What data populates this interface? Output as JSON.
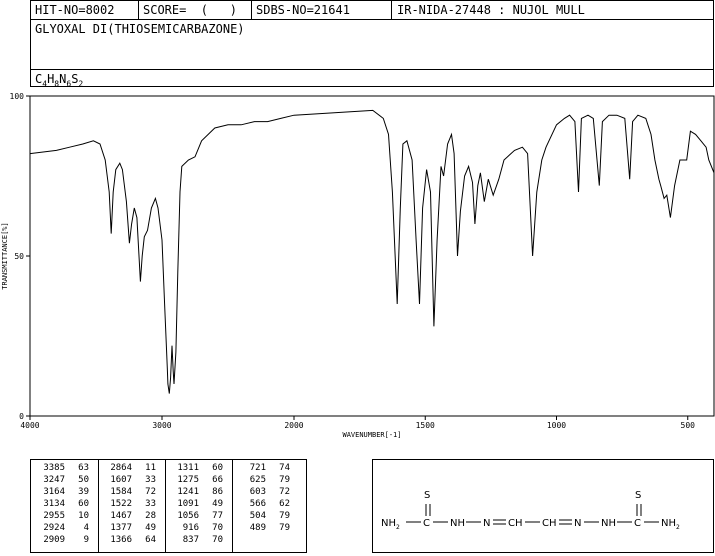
{
  "header": {
    "hit_no": "HIT-NO=8002",
    "score": "SCORE=  (   )",
    "sdbs_no": "SDBS-NO=21641",
    "ir_info": "IR-NIDA-27448 : NUJOL MULL",
    "compound": "GLYOXAL DI(THIOSEMICARBAZONE)",
    "formula_parts": [
      "C",
      "4",
      "H",
      "8",
      "N",
      "6",
      "S",
      "2"
    ]
  },
  "chart_data": {
    "type": "line",
    "xlabel": "WAVENUMBER[-1]",
    "ylabel": "TRANSMITTANCE[%]",
    "xlim": [
      4000,
      400
    ],
    "ylim": [
      0,
      100
    ],
    "x_ticks": [
      "4000",
      "3000",
      "2000",
      "1500",
      "1000",
      "500"
    ],
    "y_ticks": [
      "100",
      "50",
      "0"
    ],
    "x_tick_values": [
      4000,
      3000,
      2000,
      1500,
      1000,
      500
    ],
    "y_tick_values": [
      100,
      50,
      0
    ],
    "series": [
      {
        "points": [
          [
            4000,
            82
          ],
          [
            3900,
            82.5
          ],
          [
            3800,
            83
          ],
          [
            3700,
            84
          ],
          [
            3600,
            85
          ],
          [
            3520,
            86
          ],
          [
            3470,
            85
          ],
          [
            3430,
            80
          ],
          [
            3400,
            70
          ],
          [
            3385,
            57
          ],
          [
            3370,
            70
          ],
          [
            3350,
            77
          ],
          [
            3320,
            79
          ],
          [
            3300,
            77
          ],
          [
            3270,
            67
          ],
          [
            3247,
            54
          ],
          [
            3230,
            60
          ],
          [
            3210,
            65
          ],
          [
            3190,
            62
          ],
          [
            3164,
            42
          ],
          [
            3150,
            50
          ],
          [
            3134,
            56
          ],
          [
            3110,
            58
          ],
          [
            3080,
            65
          ],
          [
            3050,
            68
          ],
          [
            3030,
            65
          ],
          [
            3000,
            55
          ],
          [
            2980,
            35
          ],
          [
            2960,
            15
          ],
          [
            2955,
            10
          ],
          [
            2945,
            7
          ],
          [
            2935,
            12
          ],
          [
            2924,
            22
          ],
          [
            2915,
            14
          ],
          [
            2909,
            10
          ],
          [
            2895,
            20
          ],
          [
            2880,
            45
          ],
          [
            2864,
            70
          ],
          [
            2850,
            78
          ],
          [
            2800,
            80
          ],
          [
            2750,
            81
          ],
          [
            2700,
            86
          ],
          [
            2600,
            90
          ],
          [
            2500,
            91
          ],
          [
            2400,
            91
          ],
          [
            2300,
            92
          ],
          [
            2200,
            92
          ],
          [
            2100,
            93
          ],
          [
            2000,
            94
          ],
          [
            1900,
            94.5
          ],
          [
            1800,
            95
          ],
          [
            1700,
            95.5
          ],
          [
            1660,
            93
          ],
          [
            1640,
            88
          ],
          [
            1625,
            70
          ],
          [
            1607,
            35
          ],
          [
            1595,
            65
          ],
          [
            1585,
            85
          ],
          [
            1570,
            86
          ],
          [
            1550,
            80
          ],
          [
            1535,
            55
          ],
          [
            1522,
            35
          ],
          [
            1510,
            65
          ],
          [
            1495,
            77
          ],
          [
            1480,
            70
          ],
          [
            1467,
            28
          ],
          [
            1455,
            55
          ],
          [
            1440,
            78
          ],
          [
            1430,
            75
          ],
          [
            1415,
            85
          ],
          [
            1400,
            88
          ],
          [
            1390,
            82
          ],
          [
            1377,
            50
          ],
          [
            1366,
            64
          ],
          [
            1350,
            75
          ],
          [
            1335,
            78
          ],
          [
            1320,
            73
          ],
          [
            1311,
            60
          ],
          [
            1300,
            72
          ],
          [
            1290,
            76
          ],
          [
            1275,
            67
          ],
          [
            1260,
            74
          ],
          [
            1241,
            69
          ],
          [
            1220,
            74
          ],
          [
            1200,
            80
          ],
          [
            1160,
            83
          ],
          [
            1130,
            84
          ],
          [
            1110,
            82
          ],
          [
            1091,
            50
          ],
          [
            1075,
            70
          ],
          [
            1056,
            80
          ],
          [
            1040,
            84
          ],
          [
            1000,
            91
          ],
          [
            970,
            93
          ],
          [
            950,
            94
          ],
          [
            930,
            92
          ],
          [
            916,
            70
          ],
          [
            905,
            93
          ],
          [
            880,
            94
          ],
          [
            860,
            93
          ],
          [
            837,
            72
          ],
          [
            825,
            92
          ],
          [
            800,
            94
          ],
          [
            770,
            94
          ],
          [
            740,
            93
          ],
          [
            721,
            74
          ],
          [
            710,
            92
          ],
          [
            690,
            94
          ],
          [
            660,
            93
          ],
          [
            640,
            88
          ],
          [
            625,
            80
          ],
          [
            610,
            74
          ],
          [
            603,
            72
          ],
          [
            590,
            68
          ],
          [
            580,
            69
          ],
          [
            566,
            62
          ],
          [
            550,
            72
          ],
          [
            530,
            80
          ],
          [
            504,
            80
          ],
          [
            490,
            89
          ],
          [
            470,
            88
          ],
          [
            450,
            86
          ],
          [
            430,
            84
          ],
          [
            420,
            80
          ],
          [
            400,
            76
          ]
        ]
      }
    ]
  },
  "peak_table": {
    "columns": [
      [
        [
          "3385",
          "63"
        ],
        [
          "3247",
          "50"
        ],
        [
          "3164",
          "39"
        ],
        [
          "3134",
          "60"
        ],
        [
          "2955",
          "10"
        ],
        [
          "2924",
          "4"
        ],
        [
          "2909",
          "9"
        ]
      ],
      [
        [
          "2864",
          "11"
        ],
        [
          "1607",
          "33"
        ],
        [
          "1584",
          "72"
        ],
        [
          "1522",
          "33"
        ],
        [
          "1467",
          "28"
        ],
        [
          "1377",
          "49"
        ],
        [
          "1366",
          "64"
        ]
      ],
      [
        [
          "1311",
          "60"
        ],
        [
          "1275",
          "66"
        ],
        [
          "1241",
          "86"
        ],
        [
          "1091",
          "49"
        ],
        [
          "1056",
          "77"
        ],
        [
          "916",
          "70"
        ],
        [
          "837",
          "70"
        ]
      ],
      [
        [
          "721",
          "74"
        ],
        [
          "625",
          "79"
        ],
        [
          "603",
          "72"
        ],
        [
          "566",
          "62"
        ],
        [
          "504",
          "79"
        ],
        [
          "489",
          "79"
        ]
      ]
    ]
  },
  "structure": {
    "left_group": "NH",
    "left_group_sub": "2",
    "carbon": "C",
    "nh": "NH",
    "n": "N",
    "ch": "CH",
    "sulfur": "S"
  }
}
